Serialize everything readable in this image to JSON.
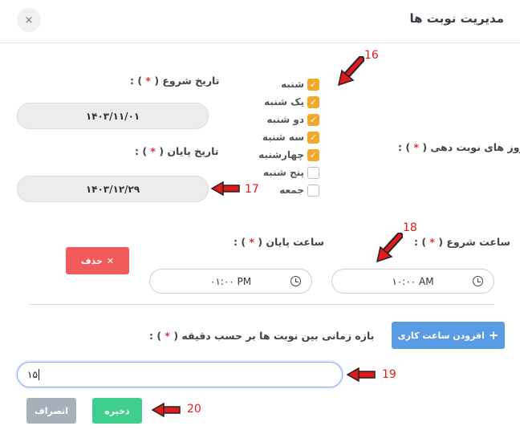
{
  "header": {
    "title": "مدیریت نوبت ها",
    "close_glyph": "×"
  },
  "start_date": {
    "label": "تاریخ شروع",
    "value": "۱۴۰۳/۱۱/۰۱"
  },
  "end_date": {
    "label": "تاریخ پایان",
    "value": "۱۴۰۳/۱۲/۲۹"
  },
  "days": {
    "label": "روز های نوبت دهی",
    "items": [
      {
        "label": "شنبه",
        "checked": true
      },
      {
        "label": "یک شنبه",
        "checked": true
      },
      {
        "label": "دو شنبه",
        "checked": true
      },
      {
        "label": "سه شنبه",
        "checked": true
      },
      {
        "label": "چهارشنبه",
        "checked": true
      },
      {
        "label": "پنج شنبه",
        "checked": false
      },
      {
        "label": "جمعه",
        "checked": false
      }
    ]
  },
  "start_time": {
    "label": "ساعت شروع",
    "value": "۱۰:۰۰ AM"
  },
  "end_time": {
    "label": "ساعت پایان",
    "value": "۰۱:۰۰ PM"
  },
  "delete_button": {
    "label": "حذف",
    "icon": "close-icon"
  },
  "add_button": {
    "label": "افزودن ساعت کاری",
    "icon": "plus-icon"
  },
  "interval": {
    "label": "بازه زمانی بین نوبت ها بر حسب دقیقه",
    "value": "۱۵"
  },
  "save_button": {
    "label": "ذخیره"
  },
  "cancel_button": {
    "label": "انصراف"
  },
  "annotations": [
    "16",
    "17",
    "18",
    "19",
    "20"
  ],
  "colors": {
    "accent_checkbox": "#f4a82a",
    "delete": "#f25b5b",
    "add": "#5a9be6",
    "save": "#3ecf8e",
    "cancel": "#a7b0ba",
    "annotation": "#e01b1b"
  }
}
